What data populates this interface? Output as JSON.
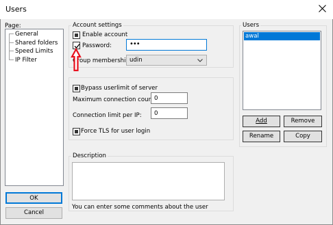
{
  "window": {
    "title": "Users"
  },
  "page_panel": {
    "label": "Page:",
    "items": [
      "General",
      "Shared folders",
      "Speed Limits",
      "IP Filter"
    ]
  },
  "account": {
    "legend": "Account settings",
    "enable_account": {
      "label": "Enable account",
      "checked": true
    },
    "password": {
      "label": "Password:",
      "checked": true,
      "value": "•••"
    },
    "group_membership": {
      "label": "Group membership:",
      "value": "udin"
    }
  },
  "server": {
    "bypass": {
      "label": "Bypass userlimit of server",
      "checked": true
    },
    "max_connections": {
      "label": "Maximum connection count:",
      "value": "0"
    },
    "limit_per_ip": {
      "label": "Connection limit per IP:",
      "value": "0"
    },
    "force_tls": {
      "label": "Force TLS for user login",
      "checked": true
    }
  },
  "description": {
    "legend": "Description",
    "value": "",
    "hint": "You can enter some comments about the user"
  },
  "users_panel": {
    "legend": "Users",
    "items": [
      "awal"
    ],
    "buttons": {
      "add": "Add",
      "remove": "Remove",
      "rename": "Rename",
      "copy": "Copy"
    }
  },
  "footer": {
    "ok": "OK",
    "cancel": "Cancel"
  },
  "annotation": {
    "type": "red-arrow",
    "color": "#e8101e"
  },
  "colors": {
    "accent": "#0078d7",
    "window_bg": "#f0f0f0"
  }
}
